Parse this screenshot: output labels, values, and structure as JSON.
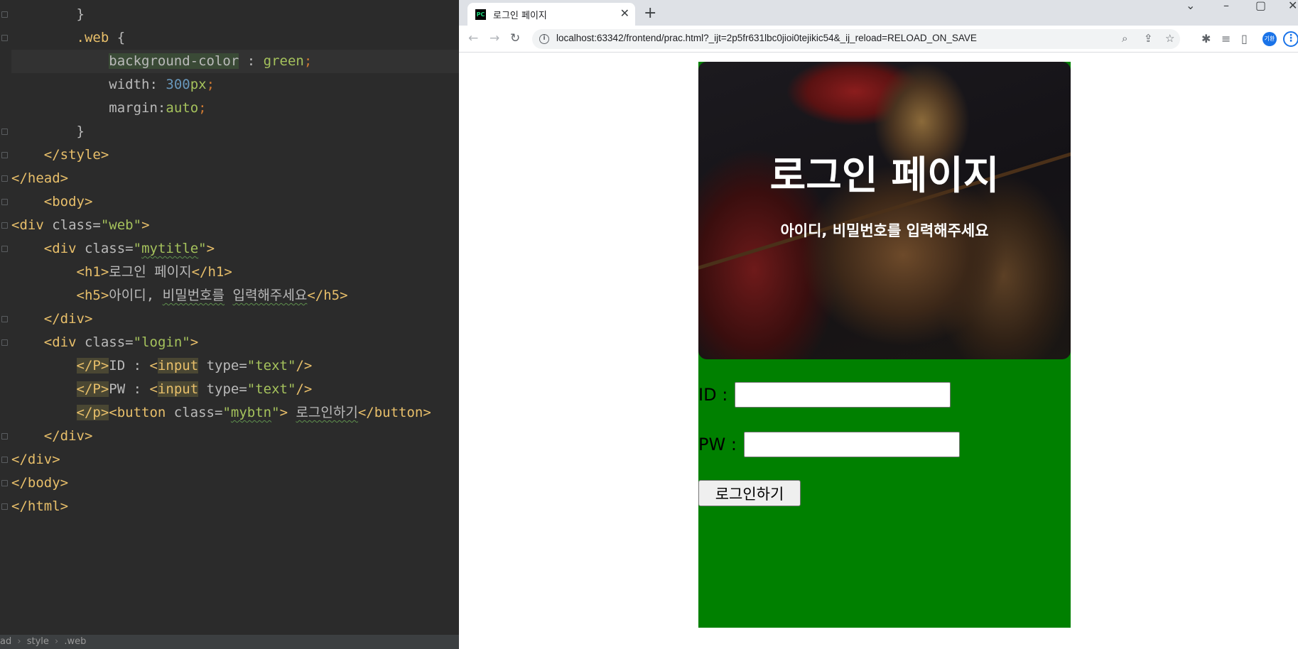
{
  "editor": {
    "lines": [
      [
        {
          "t": "        "
        },
        {
          "t": "}",
          "c": "t-attr"
        }
      ],
      [
        {
          "t": "        "
        },
        {
          "t": ".web",
          "c": "t-sel"
        },
        {
          "t": " {",
          "c": "t-attr"
        }
      ],
      [
        {
          "t": "            "
        },
        {
          "t": "background-color",
          "c": "t-prop hl-prop"
        },
        {
          "t": " : ",
          "c": "t-attr"
        },
        {
          "t": "green",
          "c": "t-val"
        },
        {
          "t": ";",
          "c": "t-kw"
        }
      ],
      [
        {
          "t": "            "
        },
        {
          "t": "width",
          "c": "t-prop"
        },
        {
          "t": ": ",
          "c": "t-attr"
        },
        {
          "t": "300",
          "c": "t-num"
        },
        {
          "t": "px",
          "c": "t-val"
        },
        {
          "t": ";",
          "c": "t-kw"
        }
      ],
      [
        {
          "t": "            "
        },
        {
          "t": "margin",
          "c": "t-prop"
        },
        {
          "t": ":",
          "c": "t-attr"
        },
        {
          "t": "auto",
          "c": "t-val"
        },
        {
          "t": ";",
          "c": "t-kw"
        }
      ],
      [
        {
          "t": "        "
        },
        {
          "t": "}",
          "c": "t-attr"
        }
      ],
      [
        {
          "t": "    "
        },
        {
          "t": "</style>",
          "c": "t-tag"
        }
      ],
      [
        {
          "t": "</head>",
          "c": "t-tag"
        }
      ],
      [
        {
          "t": "    "
        },
        {
          "t": "<body>",
          "c": "t-tag"
        }
      ],
      [
        {
          "t": "<div ",
          "c": "t-tag"
        },
        {
          "t": "class",
          "c": "t-attr"
        },
        {
          "t": "=",
          "c": "t-attr"
        },
        {
          "t": "\"web\"",
          "c": "t-val"
        },
        {
          "t": ">",
          "c": "t-tag"
        }
      ],
      [
        {
          "t": "    "
        },
        {
          "t": "<div ",
          "c": "t-tag"
        },
        {
          "t": "class",
          "c": "t-attr"
        },
        {
          "t": "=",
          "c": "t-attr"
        },
        {
          "t": "\"",
          "c": "t-val"
        },
        {
          "t": "mytitle",
          "c": "t-val squig"
        },
        {
          "t": "\"",
          "c": "t-val"
        },
        {
          "t": ">",
          "c": "t-tag"
        }
      ],
      [
        {
          "t": "        "
        },
        {
          "t": "<h1>",
          "c": "t-tag"
        },
        {
          "t": "로그인 페이지",
          "c": "t-attr"
        },
        {
          "t": "</h1>",
          "c": "t-tag"
        }
      ],
      [
        {
          "t": "        "
        },
        {
          "t": "<h5>",
          "c": "t-tag"
        },
        {
          "t": "아이디, ",
          "c": "t-attr"
        },
        {
          "t": "비밀번호를",
          "c": "t-attr squig"
        },
        {
          "t": " ",
          "c": "t-attr"
        },
        {
          "t": "입력해주세요",
          "c": "t-attr squig"
        },
        {
          "t": "</h5>",
          "c": "t-tag"
        }
      ],
      [
        {
          "t": "    "
        },
        {
          "t": "</div>",
          "c": "t-tag"
        }
      ],
      [
        {
          "t": "    "
        },
        {
          "t": "<div ",
          "c": "t-tag"
        },
        {
          "t": "class",
          "c": "t-attr"
        },
        {
          "t": "=",
          "c": "t-attr"
        },
        {
          "t": "\"login\"",
          "c": "t-val"
        },
        {
          "t": ">",
          "c": "t-tag"
        }
      ],
      [
        {
          "t": "        "
        },
        {
          "t": "</P>",
          "c": "t-tag hl-tag"
        },
        {
          "t": "ID : ",
          "c": "t-attr"
        },
        {
          "t": "<",
          "c": "t-tag"
        },
        {
          "t": "input",
          "c": "t-tag hl-tag"
        },
        {
          "t": " type",
          "c": "t-attr"
        },
        {
          "t": "=",
          "c": "t-attr"
        },
        {
          "t": "\"text\"",
          "c": "t-val"
        },
        {
          "t": "/>",
          "c": "t-tag"
        }
      ],
      [
        {
          "t": "        "
        },
        {
          "t": "</P>",
          "c": "t-tag hl-tag"
        },
        {
          "t": "PW : ",
          "c": "t-attr"
        },
        {
          "t": "<",
          "c": "t-tag"
        },
        {
          "t": "input",
          "c": "t-tag hl-tag"
        },
        {
          "t": " type",
          "c": "t-attr"
        },
        {
          "t": "=",
          "c": "t-attr"
        },
        {
          "t": "\"text\"",
          "c": "t-val"
        },
        {
          "t": "/>",
          "c": "t-tag"
        }
      ],
      [
        {
          "t": "        "
        },
        {
          "t": "</p>",
          "c": "t-tag hl-tag"
        },
        {
          "t": "<button ",
          "c": "t-tag"
        },
        {
          "t": "class",
          "c": "t-attr"
        },
        {
          "t": "=",
          "c": "t-attr"
        },
        {
          "t": "\"",
          "c": "t-val"
        },
        {
          "t": "mybtn",
          "c": "t-val squig"
        },
        {
          "t": "\"",
          "c": "t-val"
        },
        {
          "t": "> ",
          "c": "t-tag"
        },
        {
          "t": "로그인하기",
          "c": "t-attr squig"
        },
        {
          "t": "</button>",
          "c": "t-tag"
        }
      ],
      [
        {
          "t": "    "
        },
        {
          "t": "</div>",
          "c": "t-tag"
        }
      ],
      [
        {
          "t": "</div>",
          "c": "t-tag"
        }
      ],
      [
        {
          "t": "</body>",
          "c": "t-tag"
        }
      ],
      [
        {
          "t": "</html>",
          "c": "t-tag"
        }
      ]
    ],
    "breadcrumb": [
      "ad",
      "style",
      ".web"
    ]
  },
  "browser": {
    "tab_title": "로그인 페이지",
    "favicon_text": "PC",
    "url": "localhost:63342/frontend/prac.html?_ijt=2p5fr631lbc0jioi0tejikic54&_ij_reload=RELOAD_ON_SAVE",
    "profile_initials": "기환"
  },
  "page": {
    "title": "로그인 페이지",
    "subtitle": "아이디, 비밀번호를 입력해주세요",
    "id_label": "ID :",
    "pw_label": "PW :",
    "id_value": "",
    "pw_value": "",
    "button_label": "로그인하기"
  },
  "colors": {
    "page_bg": "#008000",
    "editor_bg": "#2b2b2b"
  }
}
